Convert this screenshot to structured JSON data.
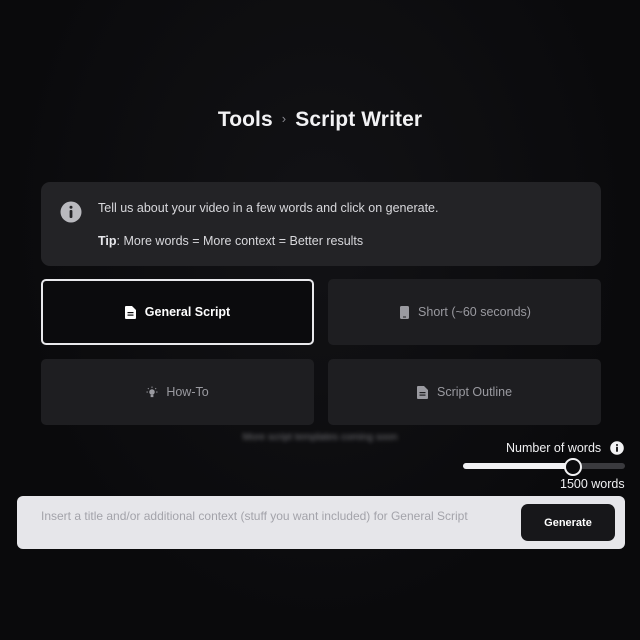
{
  "breadcrumb": {
    "root": "Tools",
    "separator": "›",
    "current": "Script Writer"
  },
  "info": {
    "icon": "info-icon",
    "line1": "Tell us about your video in a few words and click on generate.",
    "tip_label": "Tip",
    "tip_text": ": More words = More context = Better results"
  },
  "script_types": [
    {
      "label": "General Script",
      "icon": "document-icon",
      "selected": true
    },
    {
      "label": "Short (~60 seconds)",
      "icon": "phone-icon",
      "selected": false
    },
    {
      "label": "How-To",
      "icon": "lightbulb-icon",
      "selected": false
    },
    {
      "label": "Script Outline",
      "icon": "document-icon",
      "selected": false
    }
  ],
  "coming_soon": "More script templates coming soon",
  "words": {
    "label": "Number of words",
    "value": 1500,
    "display": "1500 words",
    "slider_fraction": 0.68
  },
  "prompt": {
    "placeholder": "Insert a title and/or additional context (stuff you want included) for General Script",
    "value": ""
  },
  "generate_label": "Generate",
  "colors": {
    "background": "#0b0b0d",
    "card": "#1e1e21",
    "info_box": "#232326",
    "input_bar": "#e6e6ea",
    "button": "#17171a"
  }
}
